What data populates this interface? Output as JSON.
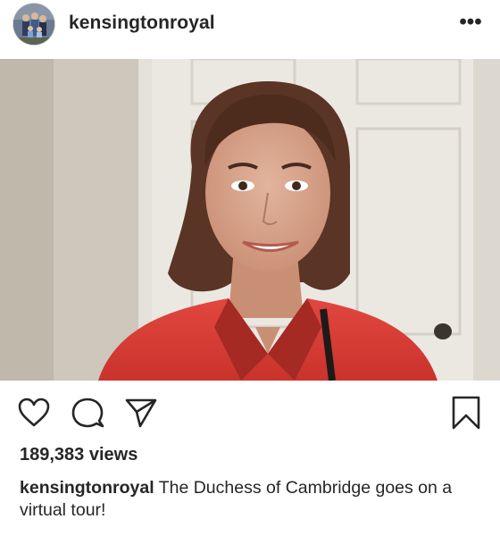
{
  "post": {
    "username": "kensingtonroyal",
    "more_label": "•••"
  },
  "media": {
    "type": "video",
    "tag_icon": "person-icon",
    "sound_icon": "speaker-icon"
  },
  "actions": {
    "like_icon": "heart-icon",
    "comment_icon": "comment-icon",
    "share_icon": "send-icon",
    "save_icon": "bookmark-icon"
  },
  "stats": {
    "views": "189,383 views"
  },
  "caption": {
    "username": "kensingtonroyal",
    "text": "The Duchess of Cambridge goes on a virtual tour!"
  }
}
